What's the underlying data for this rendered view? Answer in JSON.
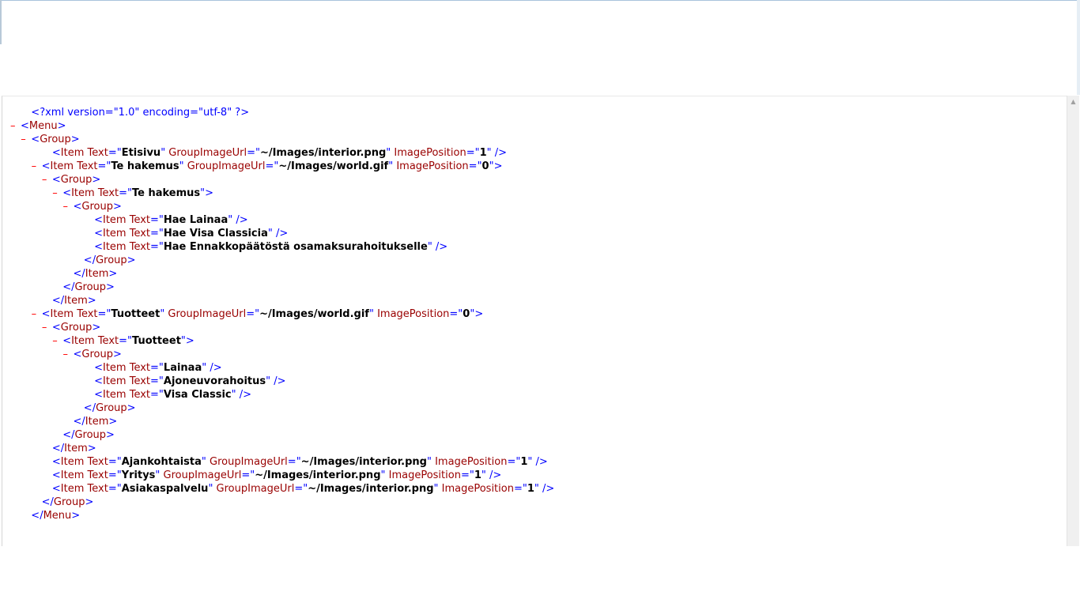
{
  "scrollbar": {
    "up_arrow": "▲"
  },
  "xml": {
    "lines": [
      {
        "indent": 1,
        "toggle": "",
        "kind": "pi",
        "text": "<?xml version=\"1.0\" encoding=\"utf-8\" ?>"
      },
      {
        "indent": 0,
        "toggle": "–",
        "kind": "open",
        "tag": "Menu",
        "attrs": []
      },
      {
        "indent": 1,
        "toggle": "–",
        "kind": "open",
        "tag": "Group",
        "attrs": []
      },
      {
        "indent": 3,
        "toggle": "",
        "kind": "empty",
        "tag": "Item",
        "attrs": [
          {
            "name": "Text",
            "value": "Etisivu"
          },
          {
            "name": "GroupImageUrl",
            "value": "~/Images/interior.png"
          },
          {
            "name": "ImagePosition",
            "value": "1"
          }
        ]
      },
      {
        "indent": 2,
        "toggle": "–",
        "kind": "open",
        "tag": "Item",
        "attrs": [
          {
            "name": "Text",
            "value": "Te hakemus"
          },
          {
            "name": "GroupImageUrl",
            "value": "~/Images/world.gif"
          },
          {
            "name": "ImagePosition",
            "value": "0"
          }
        ]
      },
      {
        "indent": 3,
        "toggle": "–",
        "kind": "open",
        "tag": "Group",
        "attrs": []
      },
      {
        "indent": 4,
        "toggle": "–",
        "kind": "open",
        "tag": "Item",
        "attrs": [
          {
            "name": "Text",
            "value": "Te hakemus"
          }
        ]
      },
      {
        "indent": 5,
        "toggle": "–",
        "kind": "open",
        "tag": "Group",
        "attrs": []
      },
      {
        "indent": 7,
        "toggle": "",
        "kind": "empty",
        "tag": "Item",
        "attrs": [
          {
            "name": "Text",
            "value": "Hae Lainaa"
          }
        ]
      },
      {
        "indent": 7,
        "toggle": "",
        "kind": "empty",
        "tag": "Item",
        "attrs": [
          {
            "name": "Text",
            "value": "Hae Visa Classicia"
          }
        ]
      },
      {
        "indent": 7,
        "toggle": "",
        "kind": "empty",
        "tag": "Item",
        "attrs": [
          {
            "name": "Text",
            "value": "Hae Ennakkopäätöstä osamaksurahoitukselle"
          }
        ]
      },
      {
        "indent": 6,
        "toggle": "",
        "kind": "close",
        "tag": "Group"
      },
      {
        "indent": 5,
        "toggle": "",
        "kind": "close",
        "tag": "Item"
      },
      {
        "indent": 4,
        "toggle": "",
        "kind": "close",
        "tag": "Group"
      },
      {
        "indent": 3,
        "toggle": "",
        "kind": "close",
        "tag": "Item"
      },
      {
        "indent": 2,
        "toggle": "–",
        "kind": "open",
        "tag": "Item",
        "attrs": [
          {
            "name": "Text",
            "value": "Tuotteet"
          },
          {
            "name": "GroupImageUrl",
            "value": "~/Images/world.gif"
          },
          {
            "name": "ImagePosition",
            "value": "0"
          }
        ]
      },
      {
        "indent": 3,
        "toggle": "–",
        "kind": "open",
        "tag": "Group",
        "attrs": []
      },
      {
        "indent": 4,
        "toggle": "–",
        "kind": "open",
        "tag": "Item",
        "attrs": [
          {
            "name": "Text",
            "value": "Tuotteet"
          }
        ]
      },
      {
        "indent": 5,
        "toggle": "–",
        "kind": "open",
        "tag": "Group",
        "attrs": []
      },
      {
        "indent": 7,
        "toggle": "",
        "kind": "empty",
        "tag": "Item",
        "attrs": [
          {
            "name": "Text",
            "value": "Lainaa"
          }
        ]
      },
      {
        "indent": 7,
        "toggle": "",
        "kind": "empty",
        "tag": "Item",
        "attrs": [
          {
            "name": "Text",
            "value": "Ajoneuvorahoitus"
          }
        ]
      },
      {
        "indent": 7,
        "toggle": "",
        "kind": "empty",
        "tag": "Item",
        "attrs": [
          {
            "name": "Text",
            "value": "Visa Classic"
          }
        ]
      },
      {
        "indent": 6,
        "toggle": "",
        "kind": "close",
        "tag": "Group"
      },
      {
        "indent": 5,
        "toggle": "",
        "kind": "close",
        "tag": "Item"
      },
      {
        "indent": 4,
        "toggle": "",
        "kind": "close",
        "tag": "Group"
      },
      {
        "indent": 3,
        "toggle": "",
        "kind": "close",
        "tag": "Item"
      },
      {
        "indent": 3,
        "toggle": "",
        "kind": "empty",
        "tag": "Item",
        "attrs": [
          {
            "name": "Text",
            "value": "Ajankohtaista"
          },
          {
            "name": "GroupImageUrl",
            "value": "~/Images/interior.png"
          },
          {
            "name": "ImagePosition",
            "value": "1"
          }
        ]
      },
      {
        "indent": 3,
        "toggle": "",
        "kind": "empty",
        "tag": "Item",
        "attrs": [
          {
            "name": "Text",
            "value": "Yritys"
          },
          {
            "name": "GroupImageUrl",
            "value": "~/Images/interior.png"
          },
          {
            "name": "ImagePosition",
            "value": "1"
          }
        ]
      },
      {
        "indent": 3,
        "toggle": "",
        "kind": "empty",
        "tag": "Item",
        "attrs": [
          {
            "name": "Text",
            "value": "Asiakaspalvelu"
          },
          {
            "name": "GroupImageUrl",
            "value": "~/Images/interior.png"
          },
          {
            "name": "ImagePosition",
            "value": "1"
          }
        ]
      },
      {
        "indent": 2,
        "toggle": "",
        "kind": "close",
        "tag": "Group"
      },
      {
        "indent": 1,
        "toggle": "",
        "kind": "close",
        "tag": "Menu"
      }
    ]
  }
}
